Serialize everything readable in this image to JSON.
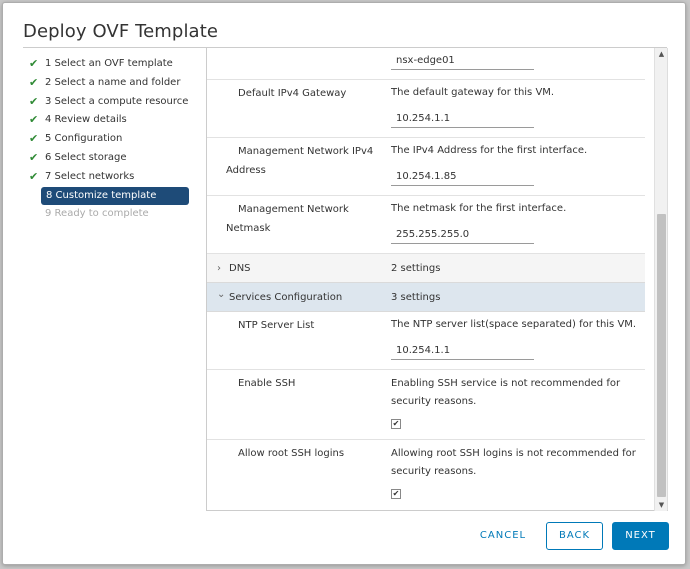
{
  "dialog": {
    "title": "Deploy OVF Template"
  },
  "steps": [
    {
      "label": "1 Select an OVF template",
      "state": "done"
    },
    {
      "label": "2 Select a name and folder",
      "state": "done"
    },
    {
      "label": "3 Select a compute resource",
      "state": "done"
    },
    {
      "label": "4 Review details",
      "state": "done"
    },
    {
      "label": "5 Configuration",
      "state": "done"
    },
    {
      "label": "6 Select storage",
      "state": "done"
    },
    {
      "label": "7 Select networks",
      "state": "done"
    },
    {
      "label": "8 Customize template",
      "state": "active"
    },
    {
      "label": "9 Ready to complete",
      "state": "disabled"
    }
  ],
  "form": {
    "hostname_value": "nsx-edge01",
    "gateway": {
      "label": "Default IPv4 Gateway",
      "desc": "The default gateway for this VM.",
      "value": "10.254.1.1"
    },
    "mgmt_ip": {
      "label_line1": "Management Network IPv4",
      "label_line2": "Address",
      "desc": "The IPv4 Address for the first interface.",
      "value": "10.254.1.85"
    },
    "mgmt_netmask": {
      "label_line1": "Management Network",
      "label_line2": "Netmask",
      "desc": "The netmask for the first interface.",
      "value": "255.255.255.0"
    },
    "dns": {
      "name": "DNS",
      "count": "2 settings",
      "chevron": "›"
    },
    "services": {
      "name": "Services Configuration",
      "count": "3 settings",
      "chevron": "⌄"
    },
    "ntp": {
      "label": "NTP Server List",
      "desc": "The NTP server list(space separated) for this VM.",
      "value": "10.254.1.1"
    },
    "ssh": {
      "label": "Enable SSH",
      "desc_line1": "Enabling SSH service is not recommended for",
      "desc_line2": "security reasons.",
      "checked": true
    },
    "root_ssh": {
      "label": "Allow root SSH logins",
      "desc_line1": "Allowing root SSH logins is not recommended for",
      "desc_line2": "security reasons.",
      "checked": true
    }
  },
  "scroll": {
    "up_icon": "▲",
    "down_icon": "▼"
  },
  "buttons": {
    "cancel": "CANCEL",
    "back": "BACK",
    "next": "NEXT"
  },
  "colors": {
    "accent": "#0079b8",
    "active_step": "#1e4b78",
    "check": "#2f8a35",
    "section_highlight": "#dde6ee"
  }
}
